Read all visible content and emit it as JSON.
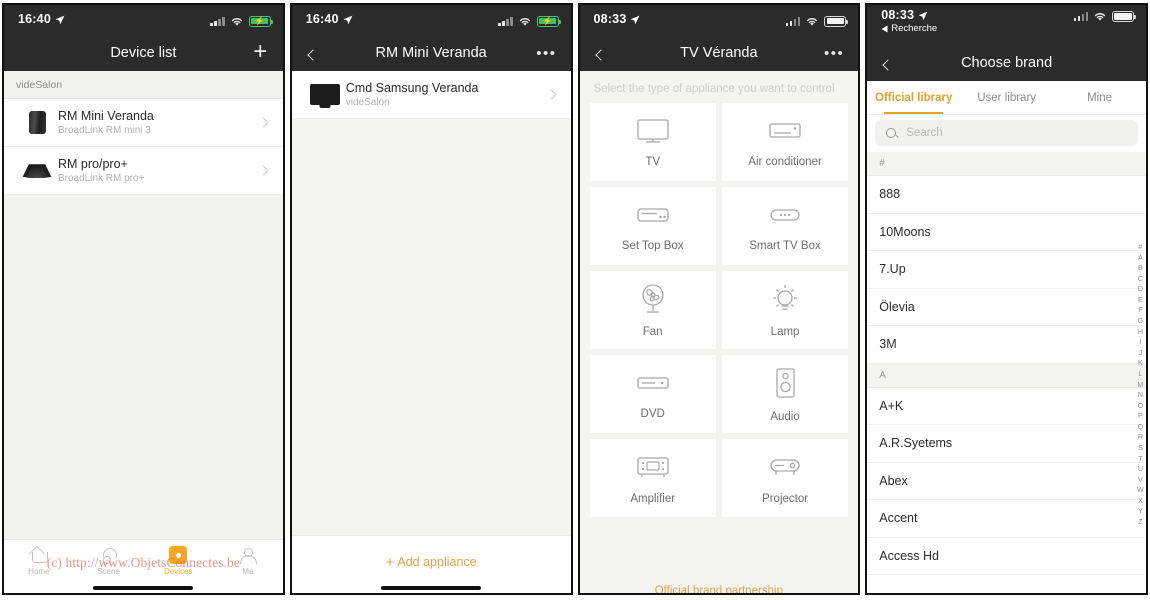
{
  "watermark": "(c) http://www.ObjetsConnectes.be",
  "panel1": {
    "status": {
      "time": "16:40",
      "location_icon": "location-arrow-icon",
      "battery_state": "charging"
    },
    "nav": {
      "title": "Device list",
      "add_icon": "plus-icon"
    },
    "group_label": "videSalon",
    "devices": [
      {
        "name": "RM Mini Veranda",
        "sub": "BroadLink  RM mini 3",
        "icon": "rm-mini-device-icon"
      },
      {
        "name": "RM pro/pro+",
        "sub": "BroadLink  RM pro+",
        "icon": "rm-pro-device-icon"
      }
    ],
    "tabs": [
      {
        "label": "Home",
        "icon": "home-icon",
        "active": false
      },
      {
        "label": "Scene",
        "icon": "scene-icon",
        "active": false
      },
      {
        "label": "Devices",
        "icon": "devices-icon",
        "active": true
      },
      {
        "label": "Me",
        "icon": "person-icon",
        "active": false
      }
    ]
  },
  "panel2": {
    "status": {
      "time": "16:40",
      "battery_state": "charging"
    },
    "nav": {
      "title": "RM Mini Veranda",
      "back_icon": "chevron-left-icon",
      "more_icon": "ellipsis-icon"
    },
    "items": [
      {
        "name": "Cmd Samsung Veranda",
        "sub": "videSalon",
        "icon": "tv-icon"
      }
    ],
    "add_label": "Add appliance",
    "add_icon": "plus-icon"
  },
  "panel3": {
    "status": {
      "time": "08:33",
      "battery_state": "full"
    },
    "nav": {
      "title": "TV Véranda",
      "back_icon": "chevron-left-icon",
      "more_icon": "ellipsis-icon"
    },
    "hint": "Select the type of appliance you want to control",
    "appliances": [
      {
        "label": "TV",
        "icon": "tv-icon"
      },
      {
        "label": "Air conditioner",
        "icon": "air-conditioner-icon"
      },
      {
        "label": "Set Top Box",
        "icon": "set-top-box-icon"
      },
      {
        "label": "Smart TV Box",
        "icon": "smart-tv-box-icon"
      },
      {
        "label": "Fan",
        "icon": "fan-icon"
      },
      {
        "label": "Lamp",
        "icon": "lamp-icon"
      },
      {
        "label": "DVD",
        "icon": "dvd-icon"
      },
      {
        "label": "Audio",
        "icon": "audio-speaker-icon"
      },
      {
        "label": "Amplifier",
        "icon": "amplifier-icon"
      },
      {
        "label": "Projector",
        "icon": "projector-icon"
      }
    ],
    "footer": "Official brand partnership"
  },
  "panel4": {
    "status": {
      "time": "08:33",
      "back_label": "Recherche",
      "battery_state": "full"
    },
    "nav": {
      "title": "Choose brand",
      "back_icon": "chevron-left-icon"
    },
    "tabs": [
      {
        "label": "Official library",
        "active": true
      },
      {
        "label": "User library",
        "active": false
      },
      {
        "label": "Mine",
        "active": false
      }
    ],
    "search": {
      "placeholder": "Search",
      "icon": "search-icon"
    },
    "sections": [
      {
        "header": "#",
        "brands": [
          "888",
          "10Moons",
          "7.Up",
          "Ölevia",
          "3M"
        ]
      },
      {
        "header": "A",
        "brands": [
          "A+K",
          "A.R.Syetems",
          "Abex",
          "Accent",
          "Access Hd"
        ]
      }
    ],
    "alpha_index": [
      "#",
      "A",
      "B",
      "C",
      "D",
      "E",
      "F",
      "G",
      "H",
      "I",
      "J",
      "K",
      "L",
      "M",
      "N",
      "O",
      "P",
      "Q",
      "R",
      "S",
      "T",
      "U",
      "V",
      "W",
      "X",
      "Y",
      "Z"
    ]
  },
  "colors": {
    "accent": "#e0a230",
    "nav_bg": "#2b2b2b",
    "tab_active": "#f5a623",
    "watermark": "#e46a5e"
  }
}
